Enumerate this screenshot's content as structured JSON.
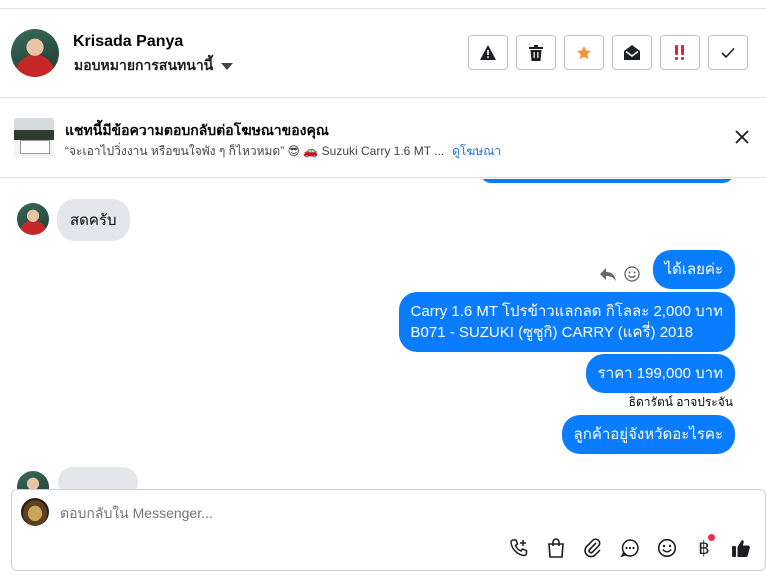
{
  "header": {
    "name": "Krisada Panya",
    "assign_label": "มอบหมายการสนทนานี้",
    "actions": [
      {
        "id": "spam",
        "icon": "warning-icon"
      },
      {
        "id": "delete",
        "icon": "trash-icon"
      },
      {
        "id": "star",
        "icon": "star-icon"
      },
      {
        "id": "mark-unread",
        "icon": "open-envelope-icon"
      },
      {
        "id": "follow-up",
        "icon": "exclamation-icon"
      },
      {
        "id": "done",
        "icon": "checkmark-icon"
      }
    ],
    "colors": {
      "star": "#f7923b",
      "follow_up": "#e41e3f"
    }
  },
  "ad_banner": {
    "title": "แชทนี้มีข้อความตอบกลับต่อโฆษณาของคุณ",
    "subtitle": "“จะเอาไปวิ่งงาน หรือขนใจพัง ๆ ก็ไหวหมด” 😎 🚗 Suzuki Carry 1.6 MT ...",
    "link": "ดูโฆษณา"
  },
  "messages": {
    "in_1": "สดครับ",
    "out_1": "ได้เลยค่ะ",
    "out_2_line1": "Carry 1.6 MT โปรข้าวแลกลด กิโลละ 2,000 บาท",
    "out_2_line2": "B071 - SUZUKI (ซูซูกิ) CARRY (แครี่) 2018",
    "out_3": "ราคา 199,000 บาท",
    "sender": "ธิดารัตน์ อาจประจัน",
    "out_4": "ลูกค้าอยู่จังหวัดอะไรคะ"
  },
  "composer": {
    "placeholder": "ตอบกลับใน Messenger...",
    "tools": [
      "call-add-icon",
      "shopping-bag-icon",
      "paperclip-icon",
      "chat-bubble-icon",
      "emoji-icon",
      "baht-icon",
      "thumbs-up-icon"
    ],
    "baht_symbol": "฿",
    "accent": "#0a7cff"
  }
}
